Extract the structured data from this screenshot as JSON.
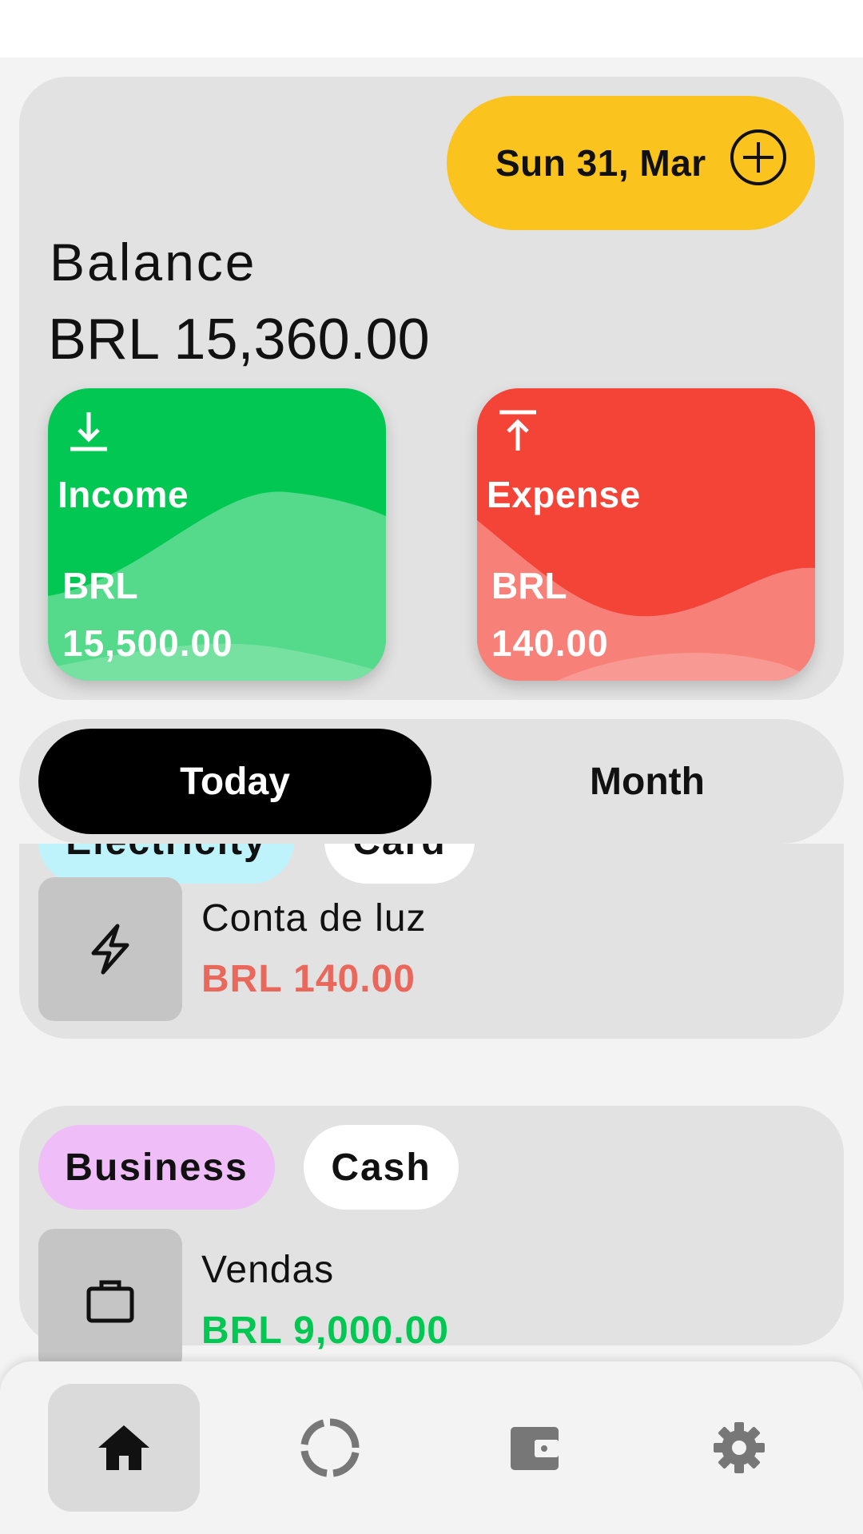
{
  "header": {
    "date_label": "Sun 31, Mar",
    "balance_label": "Balance",
    "balance_value": "BRL 15,360.00"
  },
  "summary": {
    "income": {
      "title": "Income",
      "currency": "BRL",
      "amount": "15,500.00",
      "icon": "download-icon",
      "color": "#02c853"
    },
    "expense": {
      "title": "Expense",
      "currency": "BRL",
      "amount": "140.00",
      "icon": "upload-icon",
      "color": "#f44337"
    }
  },
  "period_tabs": [
    {
      "label": "Today",
      "selected": true
    },
    {
      "label": "Month",
      "selected": false
    }
  ],
  "transactions": [
    {
      "category": "Electricity",
      "category_color": "#bff3fc",
      "method": "Card",
      "icon": "lightning-icon",
      "name": "Conta de luz",
      "amount": "BRL 140.00",
      "amount_color": "#e9685b"
    },
    {
      "category": "Business",
      "category_color": "#efbdf7",
      "method": "Cash",
      "icon": "briefcase-icon",
      "name": "Vendas",
      "amount": "BRL 9,000.00",
      "amount_color": "#02c853"
    }
  ],
  "bottom_nav": [
    {
      "icon": "home-icon",
      "active": true
    },
    {
      "icon": "chart-ring-icon",
      "active": false
    },
    {
      "icon": "wallet-icon",
      "active": false
    },
    {
      "icon": "gear-icon",
      "active": false
    }
  ],
  "colors": {
    "accent": "#fbc31e",
    "card_bg": "#e2e2e2",
    "background": "#f3f3f3"
  }
}
